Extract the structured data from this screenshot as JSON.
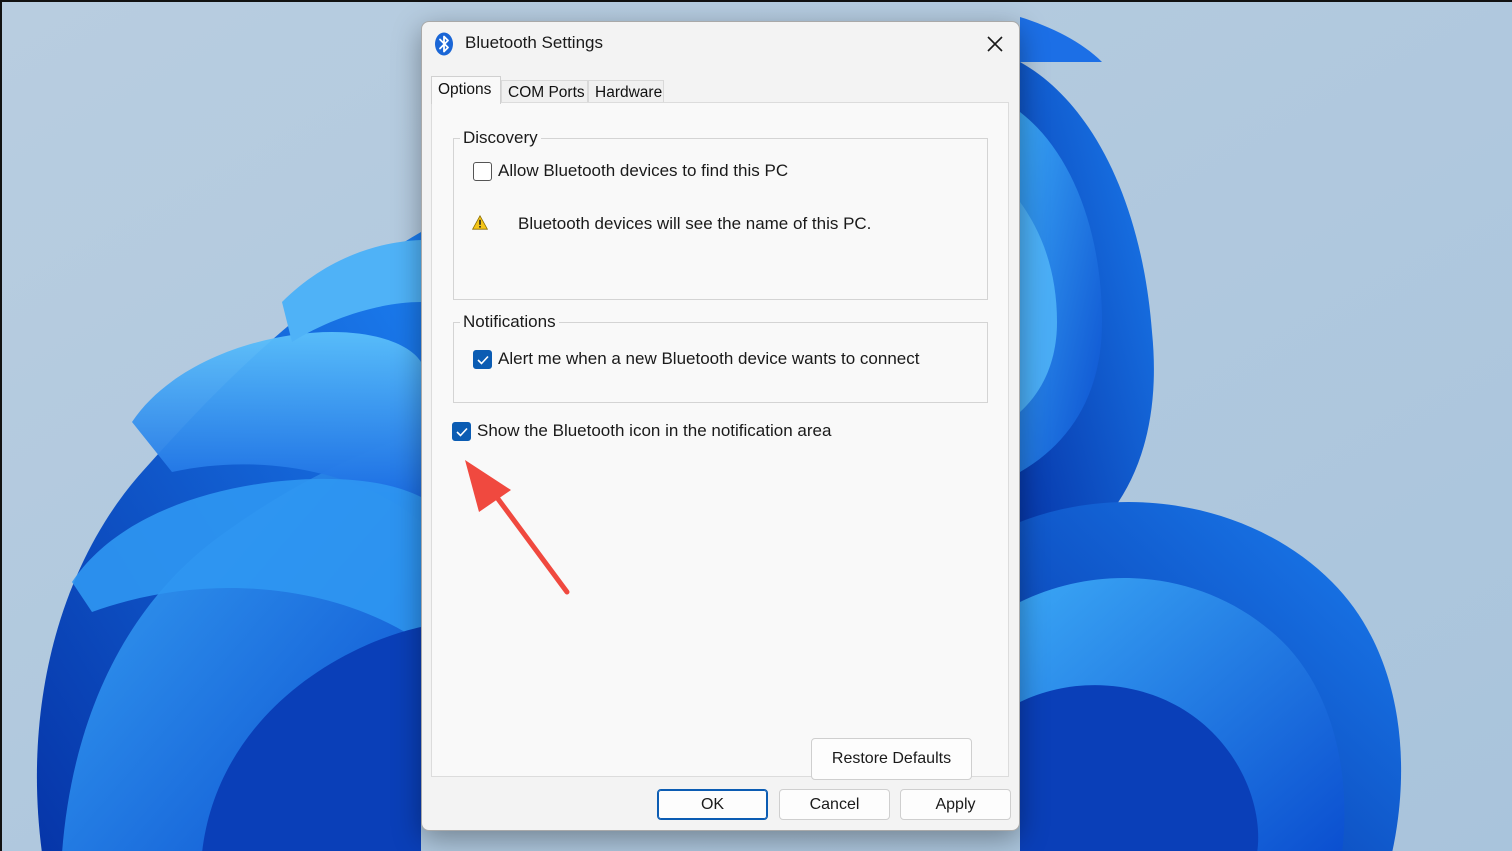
{
  "window": {
    "title": "Bluetooth Settings",
    "icon": "bluetooth-icon",
    "close_icon": "close-icon"
  },
  "tabs": [
    {
      "label": "Options",
      "active": true
    },
    {
      "label": "COM Ports",
      "active": false
    },
    {
      "label": "Hardware",
      "active": false
    }
  ],
  "discovery": {
    "legend": "Discovery",
    "allow_label": "Allow Bluetooth devices to find this PC",
    "allow_checked": false,
    "warning_icon": "warning-icon",
    "warning_text": "Bluetooth devices will see the name of this PC."
  },
  "notifications": {
    "legend": "Notifications",
    "alert_label": "Alert me when a new Bluetooth device wants to connect",
    "alert_checked": true
  },
  "show_icon": {
    "label": "Show the Bluetooth icon in the notification area",
    "checked": true
  },
  "buttons": {
    "restore_defaults": "Restore Defaults",
    "ok": "OK",
    "cancel": "Cancel",
    "apply": "Apply"
  },
  "annotation": {
    "arrow_color": "#f0493f"
  },
  "colors": {
    "accent": "#0b5cb3",
    "wallpaper_blue": "#1a6fe0"
  }
}
